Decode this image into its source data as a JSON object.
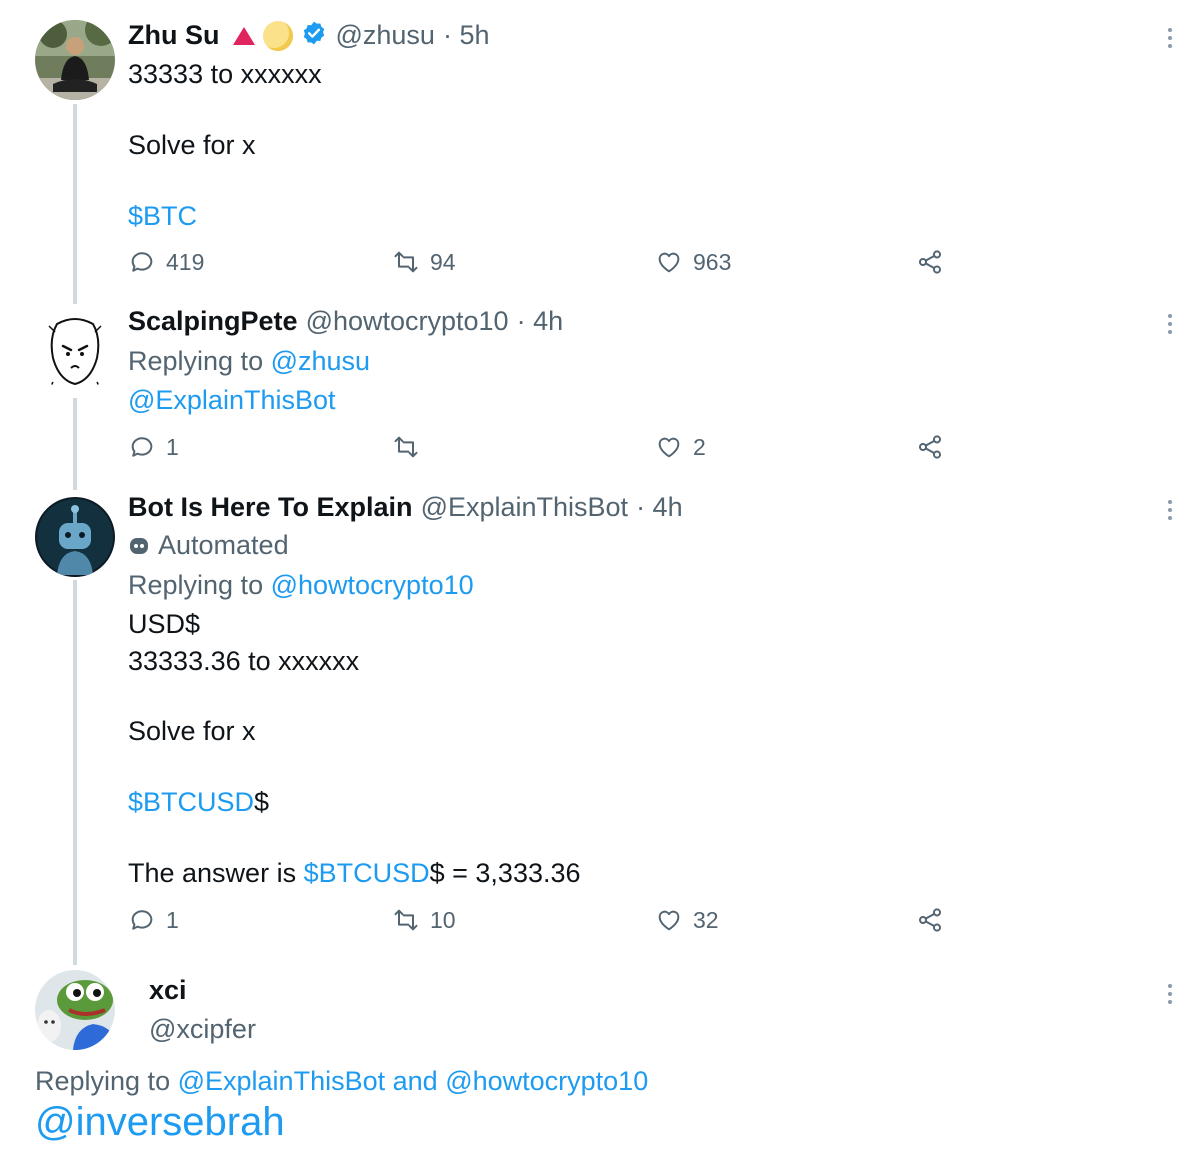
{
  "colors": {
    "text": "#0f1419",
    "muted": "#536471",
    "link": "#1d9bf0",
    "thread_line": "#cfd9de",
    "verified": "#1d9bf0"
  },
  "tweets": [
    {
      "name": "Zhu Su",
      "badges": [
        "red-triangle-icon",
        "moon-emoji-icon",
        "verified-badge-icon"
      ],
      "handle": "@zhusu",
      "time": "· 5h",
      "lines": [
        "33333 to xxxxxx",
        "Solve for x"
      ],
      "cashtag": "$BTC",
      "replies": "419",
      "retweets": "94",
      "likes": "963"
    },
    {
      "name": "ScalpingPete",
      "handle": "@howtocrypto10",
      "time": "· 4h",
      "replying_to_label": "Replying to",
      "replying_to": "@zhusu",
      "mention": "@ExplainThisBot",
      "replies": "1",
      "retweets": "",
      "likes": "2"
    },
    {
      "name": "Bot Is Here To Explain",
      "handle": "@ExplainThisBot",
      "time": "· 4h",
      "automated_label": "Automated",
      "replying_to_label": "Replying to",
      "replying_to": "@howtocrypto10",
      "line1": "USD$",
      "line2": "33333.36 to xxxxxx",
      "line3": "Solve for x",
      "cashtag": "$BTCUSD",
      "cashtag_suffix": "$",
      "answer_prefix": "The answer is",
      "answer_cashtag": "$BTCUSD",
      "answer_suffix": "$ = 3,333.36",
      "replies": "1",
      "retweets": "10",
      "likes": "32"
    },
    {
      "name": "xci",
      "handle": "@xcipfer",
      "replying_to_label": "Replying to",
      "replying_to_1": "@ExplainThisBot",
      "and_label": "and",
      "replying_to_2": "@howtocrypto10",
      "mention": "@inversebrah"
    }
  ]
}
